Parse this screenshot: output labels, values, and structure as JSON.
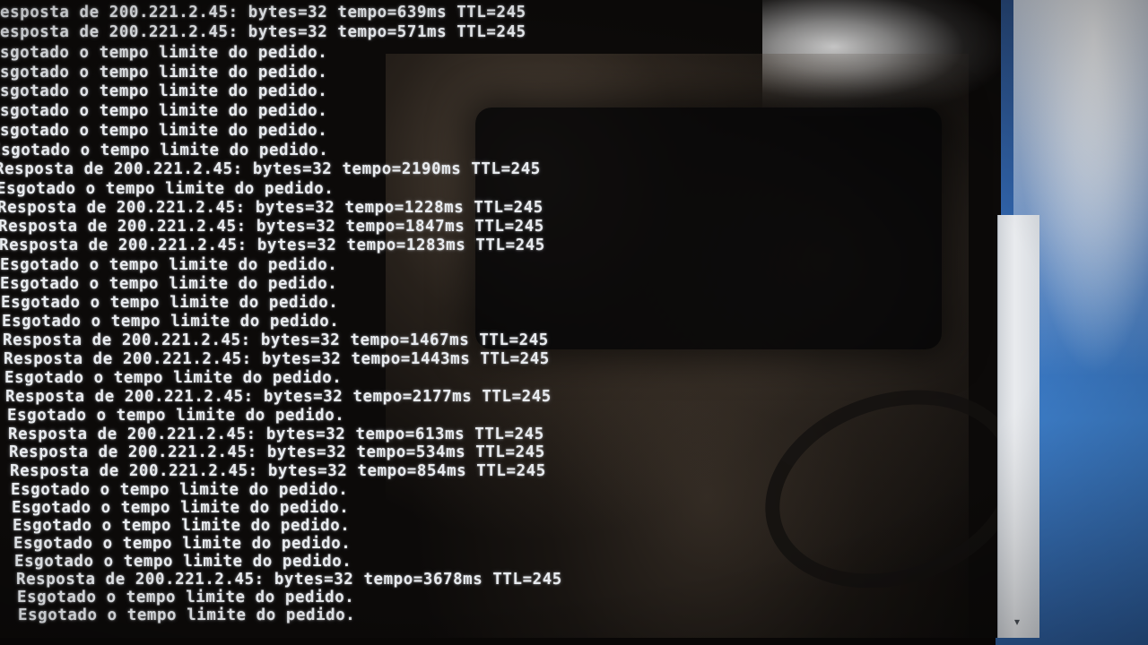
{
  "console": {
    "lines": [
      "esposta de 200.221.2.45: bytes=32 tempo=639ms TTL=245",
      "esposta de 200.221.2.45: bytes=32 tempo=571ms TTL=245",
      "sgotado o tempo limite do pedido.",
      "sgotado o tempo limite do pedido.",
      "sgotado o tempo limite do pedido.",
      "sgotado o tempo limite do pedido.",
      "sgotado o tempo limite do pedido.",
      "Esgotado o tempo limite do pedido.",
      "Resposta de 200.221.2.45: bytes=32 tempo=2190ms TTL=245",
      "Esgotado o tempo limite do pedido.",
      "Resposta de 200.221.2.45: bytes=32 tempo=1228ms TTL=245",
      "Resposta de 200.221.2.45: bytes=32 tempo=1847ms TTL=245",
      "Resposta de 200.221.2.45: bytes=32 tempo=1283ms TTL=245",
      "Esgotado o tempo limite do pedido.",
      "Esgotado o tempo limite do pedido.",
      "Esgotado o tempo limite do pedido.",
      "Esgotado o tempo limite do pedido.",
      "Resposta de 200.221.2.45: bytes=32 tempo=1467ms TTL=245",
      "Resposta de 200.221.2.45: bytes=32 tempo=1443ms TTL=245",
      "Esgotado o tempo limite do pedido.",
      "Resposta de 200.221.2.45: bytes=32 tempo=2177ms TTL=245",
      "Esgotado o tempo limite do pedido.",
      "Resposta de 200.221.2.45: bytes=32 tempo=613ms TTL=245",
      "Resposta de 200.221.2.45: bytes=32 tempo=534ms TTL=245",
      "Resposta de 200.221.2.45: bytes=32 tempo=854ms TTL=245",
      "Esgotado o tempo limite do pedido.",
      "Esgotado o tempo limite do pedido.",
      "Esgotado o tempo limite do pedido.",
      "Esgotado o tempo limite do pedido.",
      "Esgotado o tempo limite do pedido.",
      "Resposta de 200.221.2.45: bytes=32 tempo=3678ms TTL=245",
      "Esgotado o tempo limite do pedido.",
      "Esgotado o tempo limite do pedido."
    ]
  },
  "scrollbar": {
    "down_arrow_icon": "scroll-down-arrow-icon",
    "down_arrow_glyph": "▾"
  },
  "colors": {
    "console_background": "#0c0a09",
    "console_text": "#e8ebef",
    "desktop_blue": "#2f62a8"
  }
}
